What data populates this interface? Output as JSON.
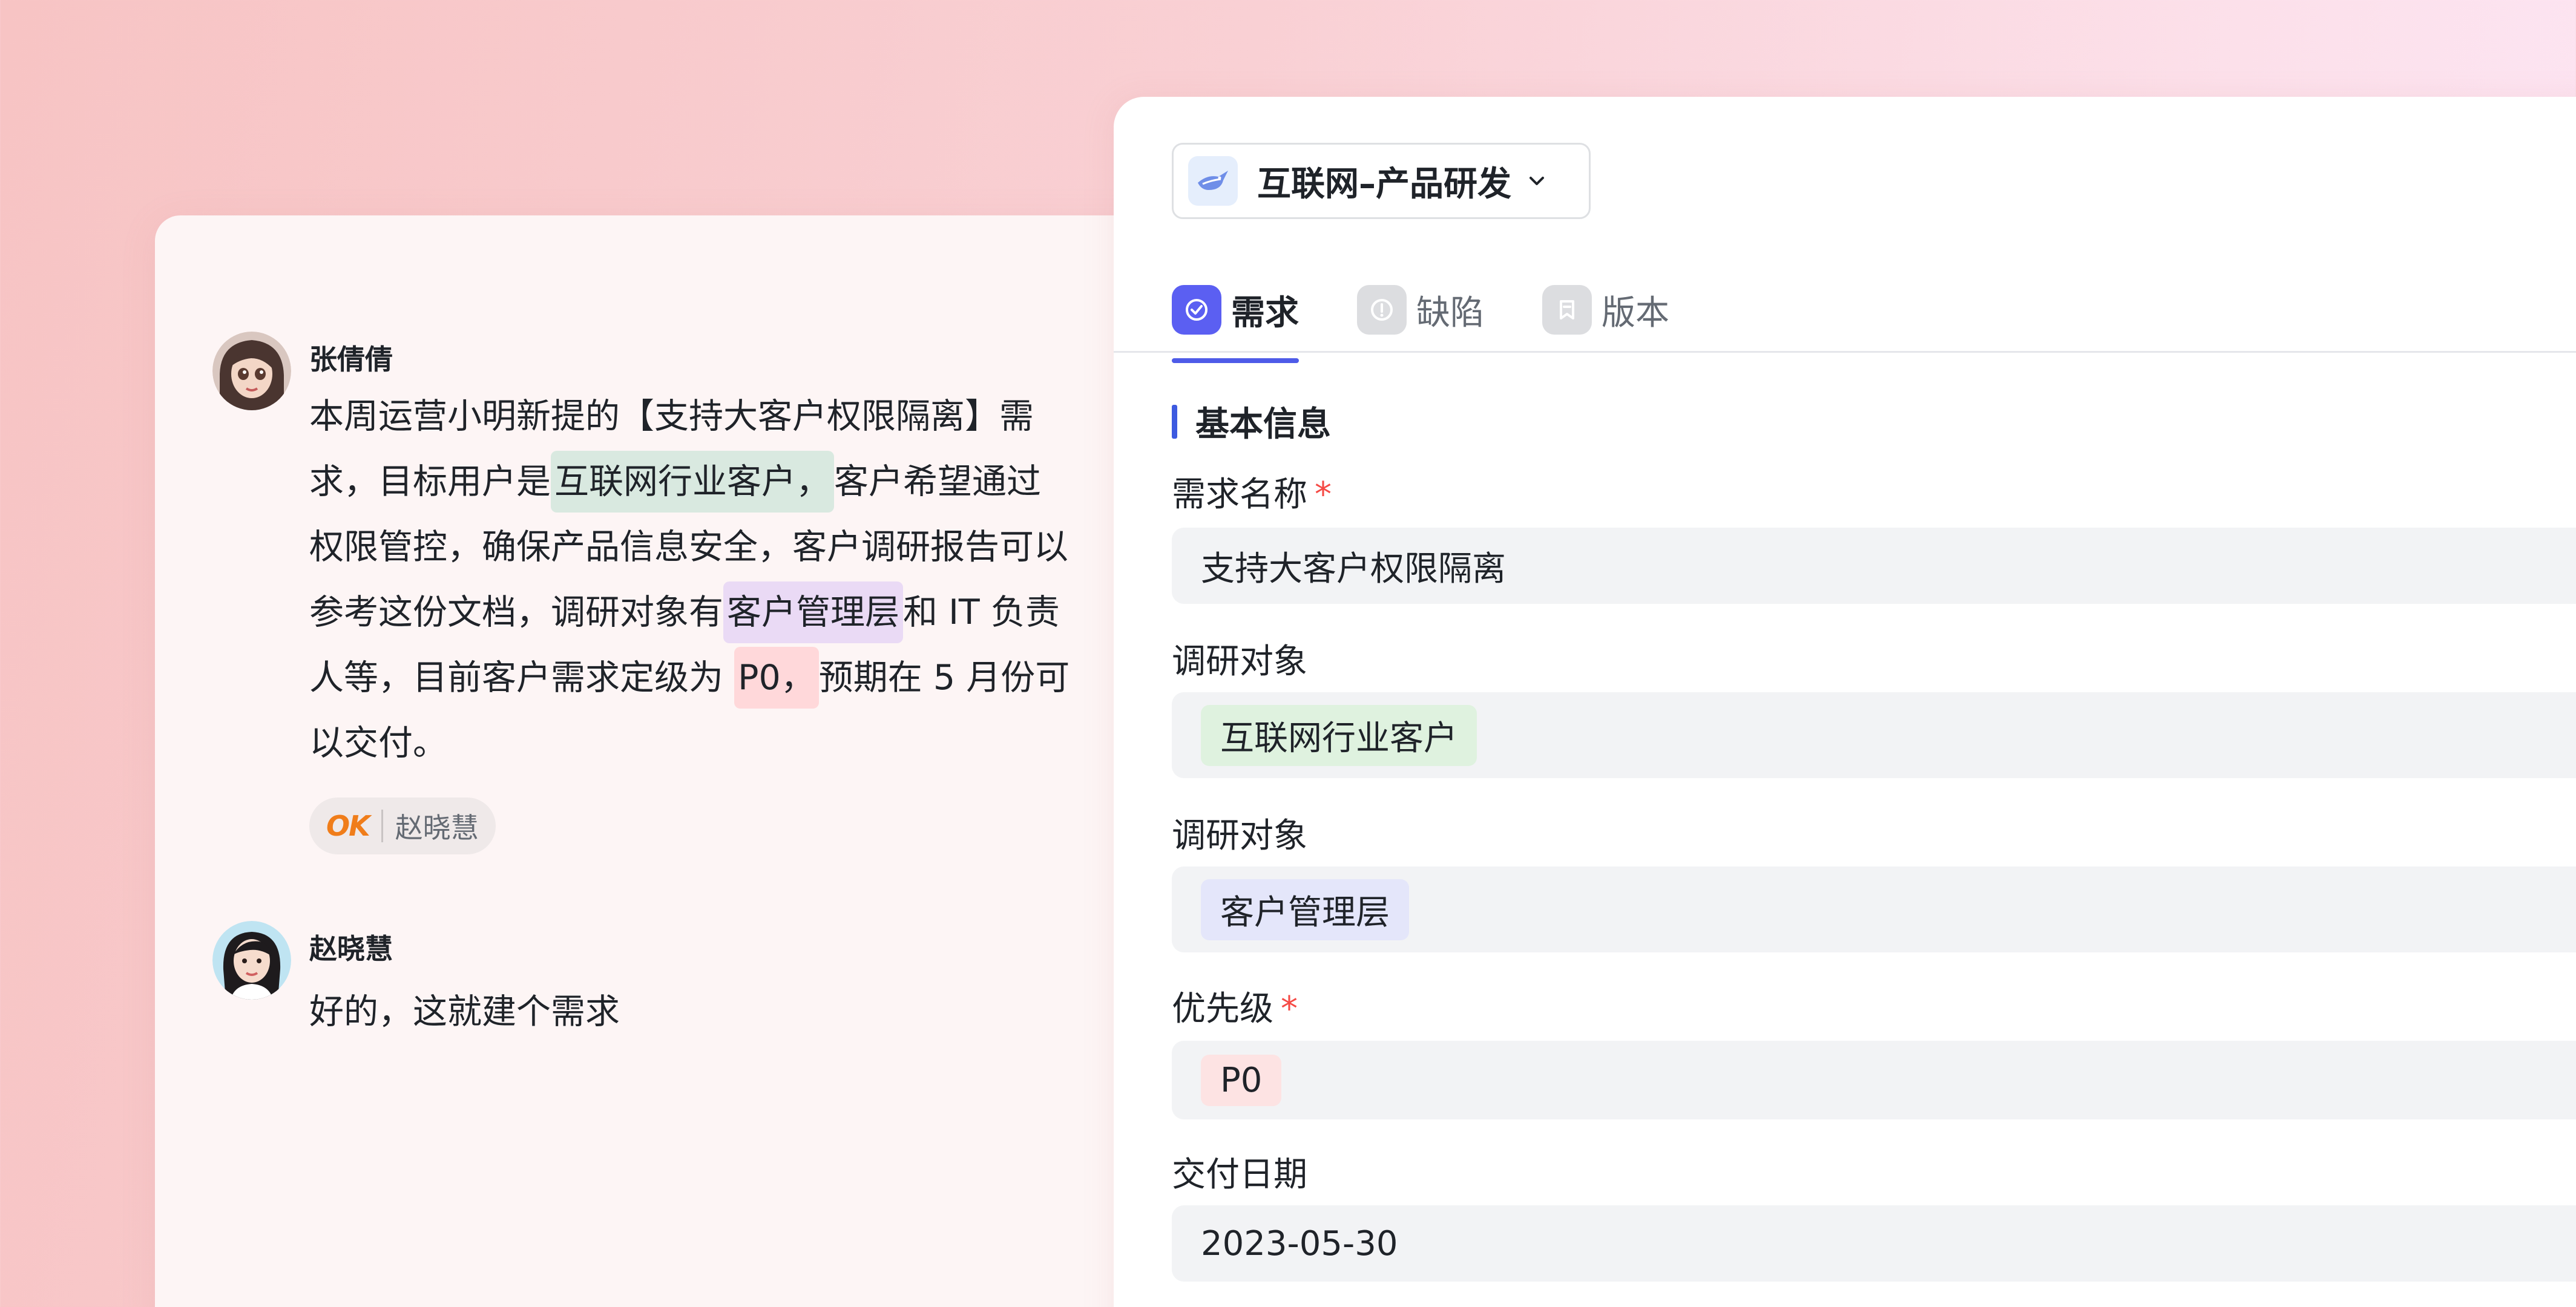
{
  "chat": {
    "messages": [
      {
        "sender": "张倩倩",
        "text_parts": [
          "本周运营小明新提的【支持大客户权限隔离】需求，目标用户是",
          "互联网行业客户，",
          "客户希望通过权限管控，确保产品信息安全，客户调研报告可以参考这份文档，调研对象有",
          "客户管理层",
          "和 IT 负责人等，目前客户需求定级为 ",
          "P0，",
          "预期在 5 月份可以交付。"
        ],
        "reaction": {
          "emoji": "OK",
          "user": "赵晓慧"
        }
      },
      {
        "sender": "赵晓慧",
        "text": "好的，这就建个需求"
      }
    ]
  },
  "form": {
    "project": {
      "name": "互联网–产品研发",
      "icon": "bird-logo-icon"
    },
    "tabs": [
      {
        "label": "需求",
        "icon": "check-circle-icon",
        "active": true
      },
      {
        "label": "缺陷",
        "icon": "alert-circle-icon",
        "active": false
      },
      {
        "label": "版本",
        "icon": "bookmark-icon",
        "active": false
      }
    ],
    "section_title": "基本信息",
    "fields": {
      "name": {
        "label": "需求名称",
        "required_mark": "*",
        "value": "支持大客户权限隔离"
      },
      "research_target_1": {
        "label": "调研对象",
        "tag": "互联网行业客户"
      },
      "research_target_2": {
        "label": "调研对象",
        "tag": "客户管理层"
      },
      "priority": {
        "label": "优先级",
        "required_mark": "*",
        "tag": "P0"
      },
      "delivery_date": {
        "label": "交付日期",
        "value": "2023-05-30"
      }
    }
  },
  "colors": {
    "accent": "#5b5ff2",
    "required": "#f54a45",
    "reaction_emoji": "#f07d1a"
  }
}
